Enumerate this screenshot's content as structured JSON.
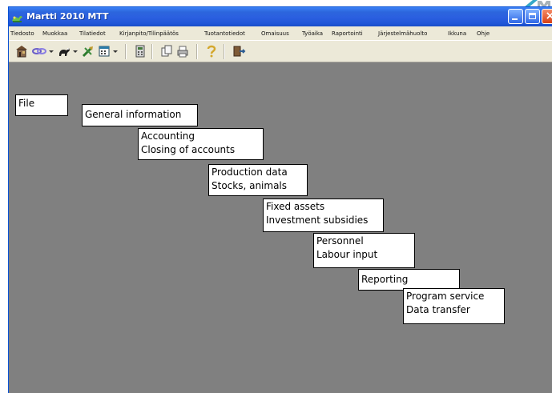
{
  "window": {
    "title": "Martti 2010 MTT"
  },
  "menu": {
    "items": [
      "Tiedosto",
      "Muokkaa",
      "Tilatiedot",
      "Kirjanpito/Tilinpäätös",
      "Tuotantotiedot",
      "Omaisuus",
      "Työaika",
      "Raportointi",
      "Järjestelmähuolto",
      "Ikkuna",
      "Ohje"
    ]
  },
  "toolbar": {
    "buttons": [
      "building-icon",
      "link-icon",
      "animal-icon",
      "tools-icon",
      "calendar-icon",
      "calculator-icon",
      "copy-icon",
      "printer-icon",
      "help-icon",
      "exit-icon"
    ]
  },
  "content": {
    "cards": [
      {
        "lines": [
          "File"
        ]
      },
      {
        "lines": [
          "General information"
        ]
      },
      {
        "lines": [
          "Accounting",
          "Closing of accounts"
        ]
      },
      {
        "lines": [
          "Production data",
          "Stocks, animals"
        ]
      },
      {
        "lines": [
          "Fixed assets",
          "Investment subsidies"
        ]
      },
      {
        "lines": [
          "Personnel",
          "Labour input"
        ]
      },
      {
        "lines": [
          "Reporting"
        ]
      },
      {
        "lines": [
          "Program service",
          "Data transfer"
        ]
      }
    ]
  },
  "colors": {
    "title_bar": "#2b5fe0",
    "client_background": "#808080",
    "card_background": "#ffffff",
    "card_border": "#000000"
  }
}
